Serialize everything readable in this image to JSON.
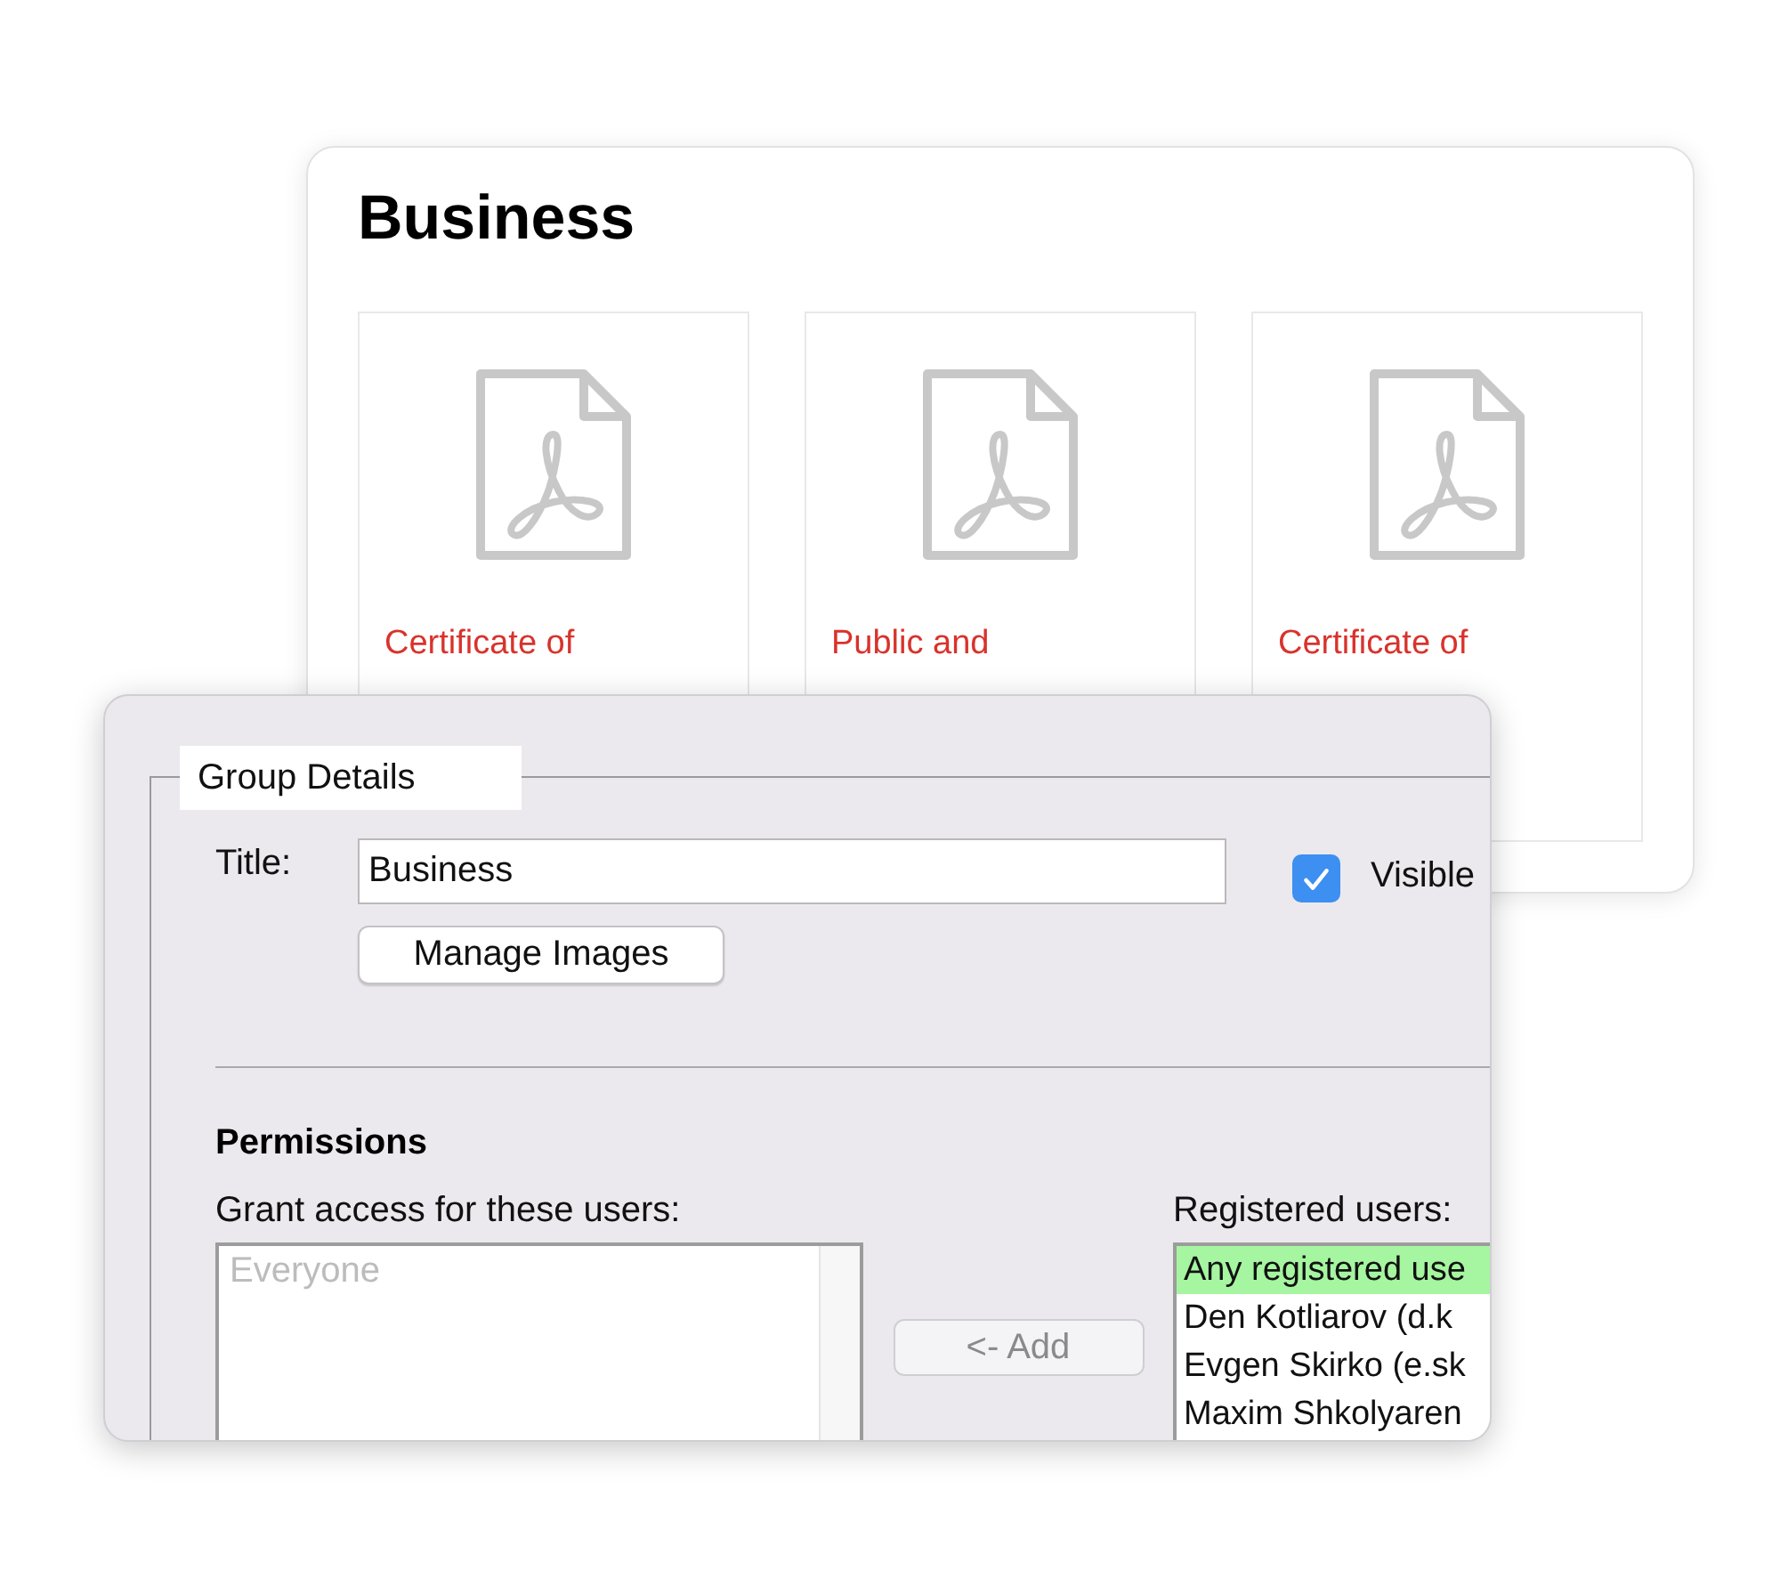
{
  "page": {
    "title": "Business",
    "documents": [
      {
        "title": "Certificate of"
      },
      {
        "title": "Public and"
      },
      {
        "title": "Certificate of"
      }
    ]
  },
  "dialog": {
    "legend": "Group Details",
    "title_label": "Title:",
    "title_value": "Business",
    "visible": {
      "label": "Visible",
      "checked": true
    },
    "manage_images_button": "Manage Images",
    "permissions_heading": "Permissions",
    "granted": {
      "label": "Grant access for these users:",
      "items": [
        {
          "name": "Everyone",
          "disabled": true
        }
      ]
    },
    "add_button": {
      "label": "<- Add",
      "disabled": true
    },
    "registered": {
      "label": "Registered users:",
      "items": [
        {
          "name": "Any registered use",
          "selected": true
        },
        {
          "name": "Den Kotliarov (d.k",
          "selected": false
        },
        {
          "name": "Evgen Skirko (e.sk",
          "selected": false
        },
        {
          "name": "Maxim Shkolyaren",
          "selected": false
        }
      ]
    }
  }
}
